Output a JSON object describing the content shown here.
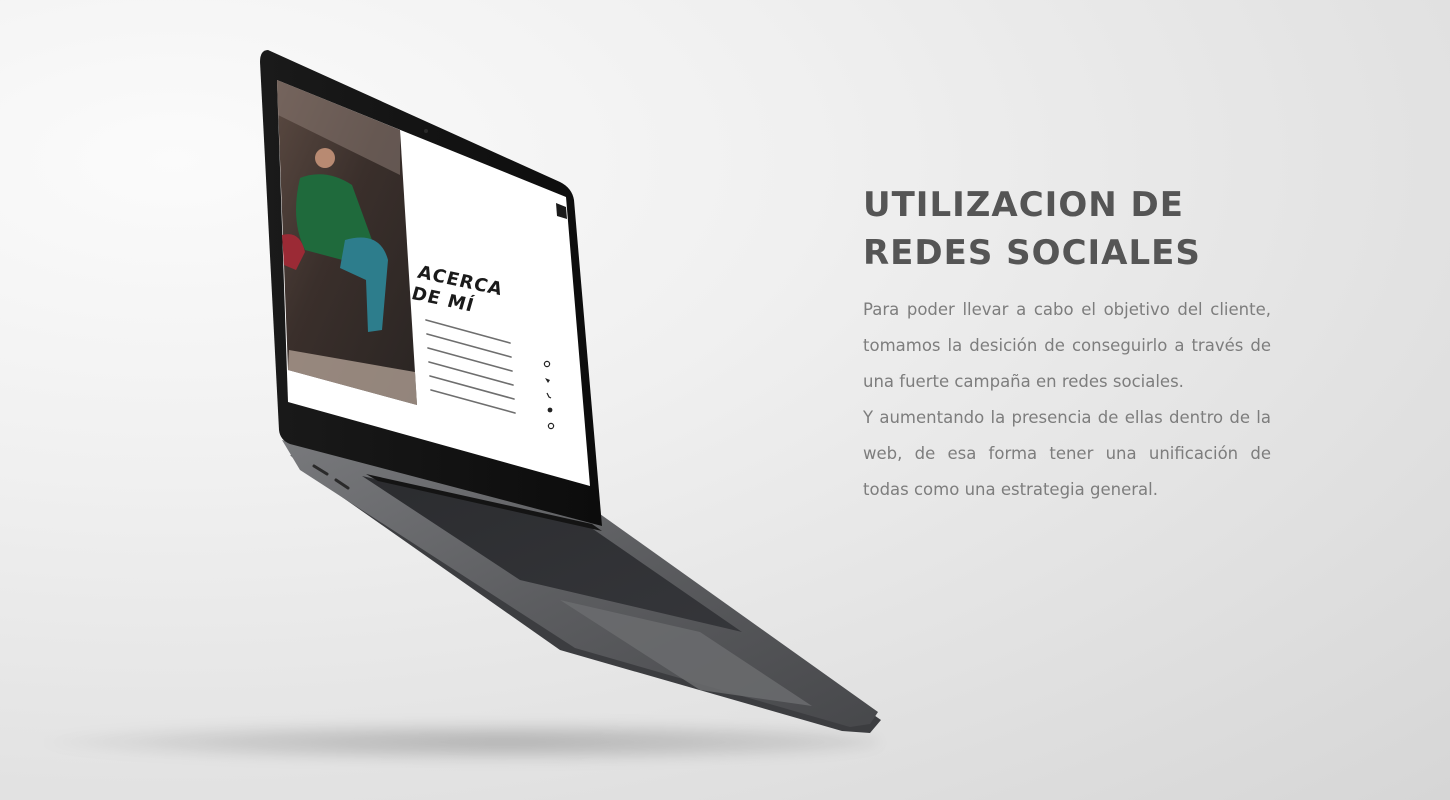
{
  "section": {
    "title_line1": "UTILIZACION DE",
    "title_line2": "REDES SOCIALES",
    "paragraph1": "Para poder llevar a cabo el objetivo del cliente, tomamos la desición de conseguirlo a través de una fuerte campaña en redes sociales.",
    "paragraph2": "Y aumentando la presencia de ellas dentro de la web, de esa forma tener una unificación de todas como una estrategia general."
  },
  "laptop_screen": {
    "heading_line1": "ACERCA",
    "heading_line2": "DE MÍ",
    "social_icons": [
      "instagram-icon",
      "twitter-icon",
      "phone-icon",
      "whatsapp-icon",
      "email-icon"
    ],
    "menu_icon": "hamburger-menu-icon"
  },
  "colors": {
    "heading": "#555555",
    "body_text": "#7d7d7d",
    "laptop_body": "#5e5f62",
    "background": "#e8e8e8"
  }
}
